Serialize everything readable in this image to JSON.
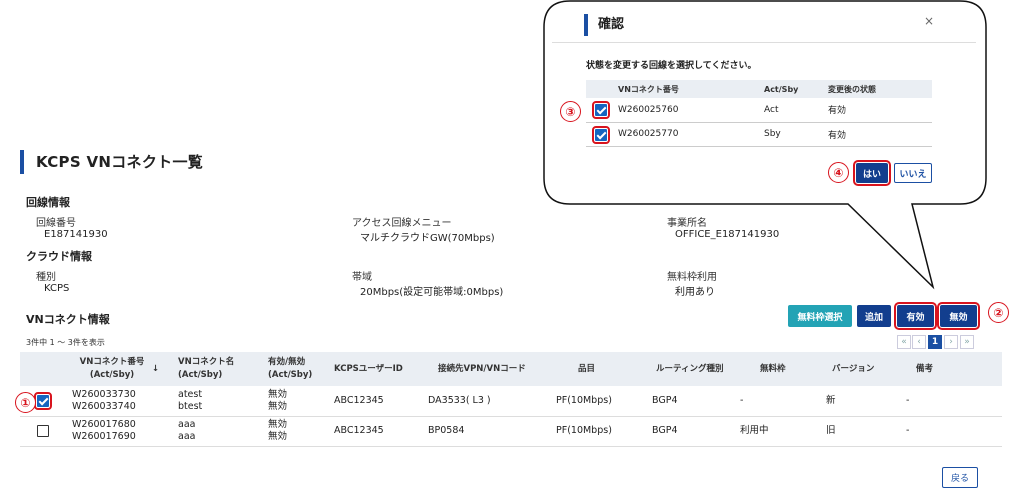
{
  "page": {
    "title": "KCPS VNコネクト一覧"
  },
  "line_info": {
    "heading": "回線情報",
    "fields": [
      {
        "label": "回線番号",
        "value": "E187141930"
      },
      {
        "label": "アクセス回線メニュー",
        "value": "マルチクラウドGW(70Mbps)"
      },
      {
        "label": "事業所名",
        "value": "OFFICE_E187141930"
      }
    ]
  },
  "cloud_info": {
    "heading": "クラウド情報",
    "fields": [
      {
        "label": "種別",
        "value": "KCPS"
      },
      {
        "label": "帯域",
        "value": "20Mbps(設定可能帯域:0Mbps)"
      },
      {
        "label": "無料枠利用",
        "value": "利用あり"
      }
    ]
  },
  "vn_section": {
    "heading": "VNコネクト情報",
    "count_text": "3件中 1 〜 3件を表示"
  },
  "buttons": {
    "free": "無料枠選択",
    "add": "追加",
    "enable": "有効",
    "disable": "無効",
    "back": "戻る"
  },
  "pagination": {
    "first": "«",
    "prev": "‹",
    "current": "1",
    "next": "›",
    "last": "»"
  },
  "table": {
    "headers": [
      "VNコネクト番号\n(Act/Sby)",
      "VNコネクト名\n(Act/Sby)",
      "有効/無効\n(Act/Sby)",
      "KCPSユーザーID",
      "接続先VPN/VNコード",
      "品目",
      "ルーティング種別",
      "無料枠",
      "バージョン",
      "備考"
    ],
    "rows": [
      {
        "checked": true,
        "no": "W260033730\nW260033740",
        "name": "atest\nbtest",
        "status": "無効\n無効",
        "user": "ABC12345",
        "vpn": "DA3533( L3 )",
        "item": "PF(10Mbps)",
        "routing": "BGP4",
        "free": "-",
        "version": "新",
        "note": "-"
      },
      {
        "checked": false,
        "no": "W260017680\nW260017690",
        "name": "aaa\naaa",
        "status": "無効\n無効",
        "user": "ABC12345",
        "vpn": "BP0584",
        "item": "PF(10Mbps)",
        "routing": "BGP4",
        "free": "利用中",
        "version": "旧",
        "note": "-"
      }
    ]
  },
  "dialog": {
    "title": "確認",
    "close": "×",
    "message": "状態を変更する回線を選択してください。",
    "headers": [
      "VNコネクト番号",
      "Act/Sby",
      "変更後の状態"
    ],
    "rows": [
      {
        "no": "W260025760",
        "type": "Act",
        "state": "有効"
      },
      {
        "no": "W260025770",
        "type": "Sby",
        "state": "有効"
      }
    ],
    "yes": "はい",
    "no": "いいえ"
  },
  "steps": {
    "s1": "①",
    "s2": "②",
    "s3": "③",
    "s4": "④"
  },
  "colors": {
    "accent": "#1b4fa3",
    "teal": "#23a3b5",
    "navy": "#123e8e",
    "highlight": "#d8141e"
  }
}
